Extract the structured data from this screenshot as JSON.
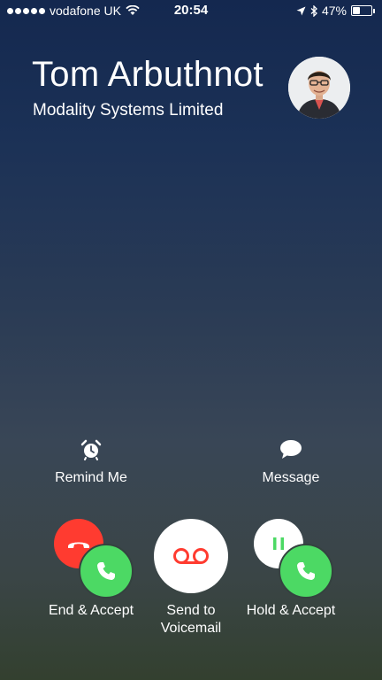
{
  "status": {
    "carrier": "vodafone UK",
    "time": "20:54",
    "battery": "47%",
    "battery_level": 0.47,
    "signal_dots": 5
  },
  "caller": {
    "name": "Tom Arbuthnot",
    "subtitle": "Modality Systems Limited",
    "avatar_icon": "person-photo"
  },
  "quick_actions": {
    "remind_label": "Remind Me",
    "remind_icon": "alarm-clock-icon",
    "message_label": "Message",
    "message_icon": "speech-bubble-icon"
  },
  "call_buttons": {
    "end_accept_label": "End & Accept",
    "voicemail_label_1": "Send to",
    "voicemail_label_2": "Voicemail",
    "hold_accept_label": "Hold & Accept"
  },
  "colors": {
    "decline_red": "#ff3b30",
    "accept_green": "#4cd964",
    "voicemail_red": "#ff3b30"
  }
}
